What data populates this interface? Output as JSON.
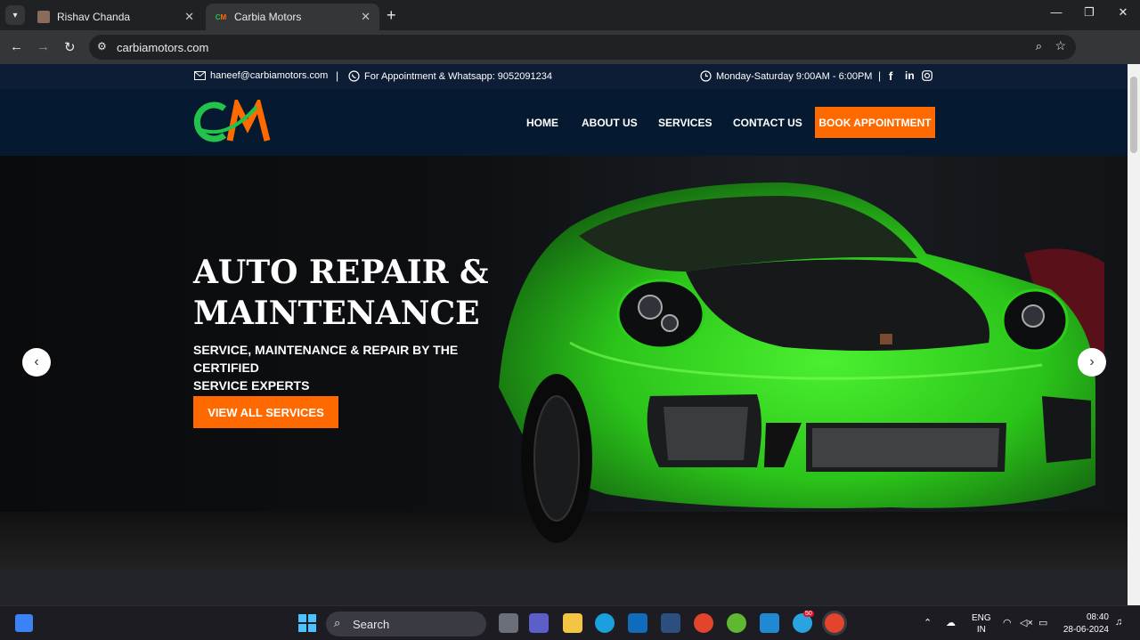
{
  "browser": {
    "tabs": [
      {
        "title": "Rishav Chanda",
        "active": false
      },
      {
        "title": "Carbia Motors",
        "active": true
      }
    ],
    "tab_search_icon": "chevron-down-icon",
    "url": "carbiamotors.com"
  },
  "site": {
    "topbar": {
      "email": "haneef@carbiamotors.com",
      "separator": "|",
      "phone": "For Appointment & Whatsapp: 9052091234",
      "hours": "Monday-Saturday 9:00AM - 6:00PM"
    },
    "logo": "CM",
    "nav": [
      "HOME",
      "ABOUT US",
      "SERVICES",
      "CONTACT US"
    ],
    "book_button": "BOOK APPOINTMENT",
    "hero": {
      "title_line1": "AUTO REPAIR &",
      "title_line2": "MAINTENANCE",
      "subtitle_line1": "SERVICE, MAINTENANCE & REPAIR BY THE CERTIFIED",
      "subtitle_line2": "SERVICE EXPERTS",
      "button": "VIEW ALL SERVICES"
    },
    "colors": {
      "accent": "#ff6a00",
      "green": "#22c34b",
      "navy": "#051a30"
    }
  },
  "taskbar": {
    "search_label": "Search",
    "lang_line1": "ENG",
    "lang_line2": "IN",
    "time": "08:40",
    "date": "28-06-2024",
    "telegram_badge": "50"
  }
}
